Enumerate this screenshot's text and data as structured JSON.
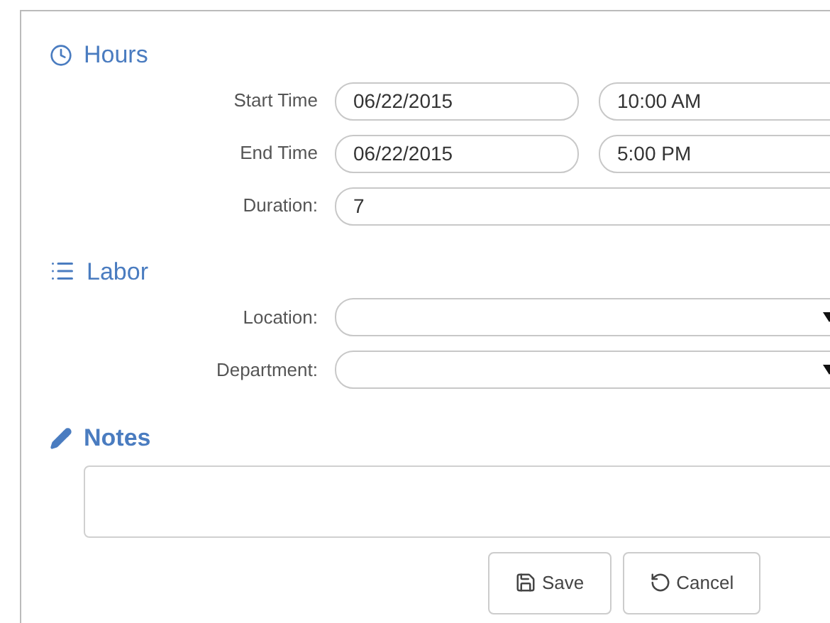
{
  "hours": {
    "title": "Hours",
    "rows": [
      {
        "label": "Start Time",
        "date": "06/22/2015",
        "time": "10:00 AM"
      },
      {
        "label": "End Time",
        "date": "06/22/2015",
        "time": "5:00 PM"
      }
    ],
    "duration": {
      "label": "Duration:",
      "value": "7"
    }
  },
  "labor": {
    "title": "Labor",
    "selects": [
      {
        "label": "Location:"
      },
      {
        "label": "Department:"
      }
    ]
  },
  "notes": {
    "title": "Notes"
  },
  "buttons": [
    {
      "kind": "save",
      "label": "Save"
    },
    {
      "kind": "cancel",
      "label": "Cancel"
    }
  ]
}
